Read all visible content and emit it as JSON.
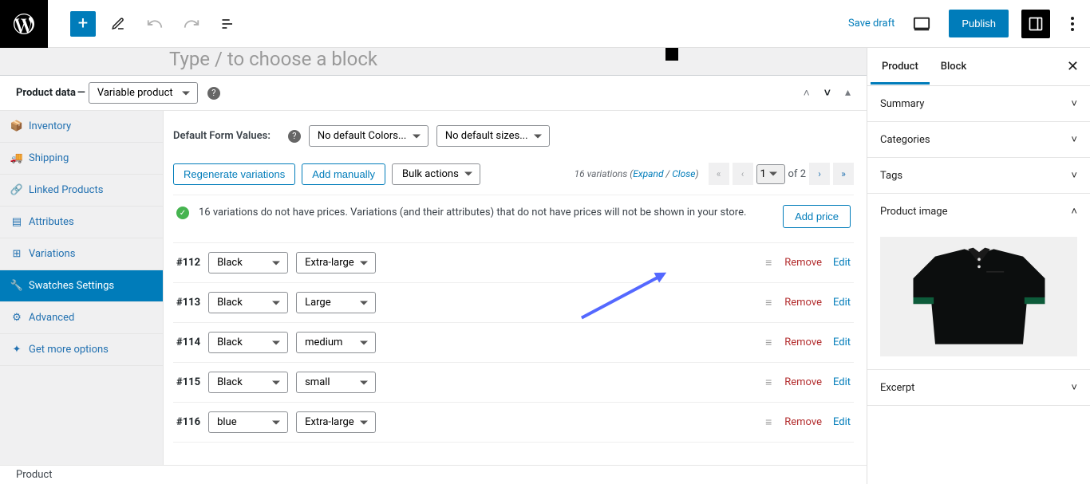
{
  "topbar": {
    "save_draft": "Save draft",
    "publish": "Publish"
  },
  "block_hint": "Type / to choose a block",
  "product_data": {
    "label": "Product data",
    "dash": "—",
    "type": "Variable product"
  },
  "tabs": {
    "inventory": "Inventory",
    "shipping": "Shipping",
    "linked": "Linked Products",
    "attributes": "Attributes",
    "variations": "Variations",
    "swatches": "Swatches Settings",
    "advanced": "Advanced",
    "more": "Get more options"
  },
  "dfv": {
    "label": "Default Form Values:",
    "colors": "No default Colors...",
    "sizes": "No default sizes..."
  },
  "actions": {
    "regenerate": "Regenerate variations",
    "add_manually": "Add manually",
    "bulk": "Bulk actions",
    "count_text": "16 variations",
    "expand": "Expand",
    "close": "Close",
    "page_current": "1",
    "of": "of",
    "total_pages": "2"
  },
  "notice": {
    "text": "16 variations do not have prices. Variations (and their attributes) that do not have prices will not be shown in your store.",
    "add_price": "Add price"
  },
  "variations": [
    {
      "id": "#112",
      "color": "Black",
      "size": "Extra-large"
    },
    {
      "id": "#113",
      "color": "Black",
      "size": "Large"
    },
    {
      "id": "#114",
      "color": "Black",
      "size": "medium"
    },
    {
      "id": "#115",
      "color": "Black",
      "size": "small"
    },
    {
      "id": "#116",
      "color": "blue",
      "size": "Extra-large"
    }
  ],
  "row_actions": {
    "remove": "Remove",
    "edit": "Edit"
  },
  "panel": {
    "tab_product": "Product",
    "tab_block": "Block",
    "summary": "Summary",
    "categories": "Categories",
    "tags": "Tags",
    "product_image": "Product image",
    "excerpt": "Excerpt"
  },
  "footer": "Product"
}
